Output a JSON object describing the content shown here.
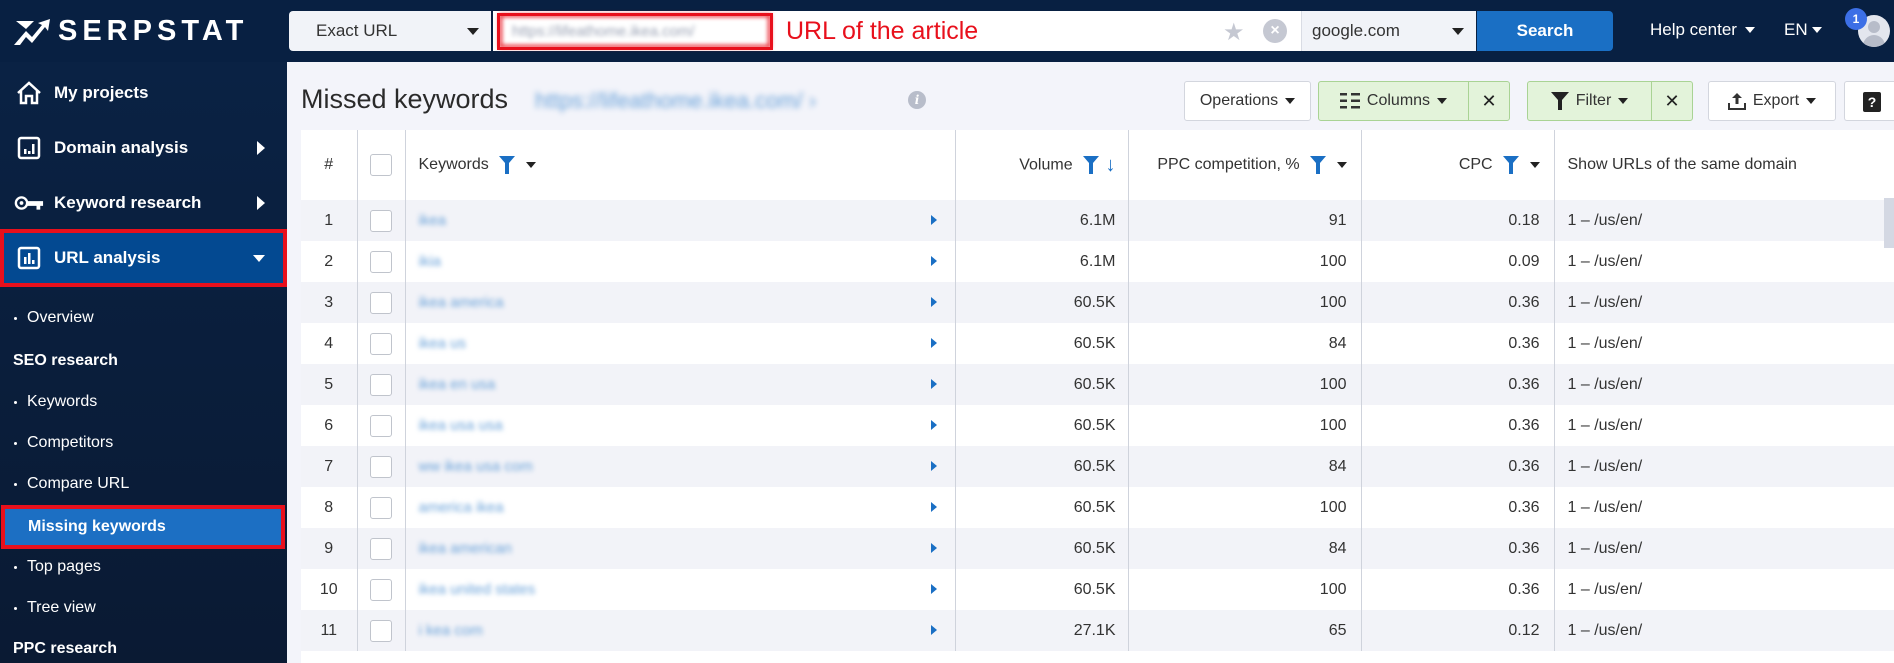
{
  "app": {
    "logo_text": "SERPSTAT"
  },
  "topbar": {
    "search_type": "Exact URL",
    "url_value": "https://lifeathome.ikea.com/",
    "url_annotation": "URL of the article",
    "engine": "google.com",
    "search_label": "Search",
    "help_center": "Help center",
    "language": "EN",
    "notification_count": "1"
  },
  "sidebar": {
    "main_items": [
      {
        "label": "My projects",
        "icon": "home-icon"
      },
      {
        "label": "Domain analysis",
        "icon": "chart-box-icon"
      },
      {
        "label": "Keyword research",
        "icon": "key-icon"
      },
      {
        "label": "URL analysis",
        "icon": "bar-chart-icon"
      }
    ],
    "overview": "Overview",
    "seo_section": "SEO research",
    "seo_items": [
      "Keywords",
      "Competitors",
      "Compare URL",
      "Missing keywords",
      "Top pages",
      "Tree view"
    ],
    "ppc_section": "PPC research"
  },
  "main": {
    "title": "Missed keywords",
    "url": "https://lifeathome.ikea.com/ ›",
    "toolbar": {
      "operations": "Operations",
      "columns": "Columns",
      "filter": "Filter",
      "export": "Export",
      "help": "?"
    }
  },
  "table": {
    "headers": {
      "num": "#",
      "keywords": "Keywords",
      "volume": "Volume",
      "ppc": "PPC competition, %",
      "cpc": "CPC",
      "urls": "Show URLs of the same domain"
    },
    "rows": [
      {
        "num": "1",
        "keyword": "ikea",
        "volume": "6.1M",
        "ppc": "91",
        "cpc": "0.18",
        "url": "1 – /us/en/"
      },
      {
        "num": "2",
        "keyword": "ikia",
        "volume": "6.1M",
        "ppc": "100",
        "cpc": "0.09",
        "url": "1 – /us/en/"
      },
      {
        "num": "3",
        "keyword": "ikea america",
        "volume": "60.5K",
        "ppc": "100",
        "cpc": "0.36",
        "url": "1 – /us/en/"
      },
      {
        "num": "4",
        "keyword": "ikea us",
        "volume": "60.5K",
        "ppc": "84",
        "cpc": "0.36",
        "url": "1 – /us/en/"
      },
      {
        "num": "5",
        "keyword": "ikea en usa",
        "volume": "60.5K",
        "ppc": "100",
        "cpc": "0.36",
        "url": "1 – /us/en/"
      },
      {
        "num": "6",
        "keyword": "ikea usa usa",
        "volume": "60.5K",
        "ppc": "100",
        "cpc": "0.36",
        "url": "1 – /us/en/"
      },
      {
        "num": "7",
        "keyword": "ww ikea usa com",
        "volume": "60.5K",
        "ppc": "84",
        "cpc": "0.36",
        "url": "1 – /us/en/"
      },
      {
        "num": "8",
        "keyword": "america ikea",
        "volume": "60.5K",
        "ppc": "100",
        "cpc": "0.36",
        "url": "1 – /us/en/"
      },
      {
        "num": "9",
        "keyword": "ikea american",
        "volume": "60.5K",
        "ppc": "84",
        "cpc": "0.36",
        "url": "1 – /us/en/"
      },
      {
        "num": "10",
        "keyword": "ikea united states",
        "volume": "60.5K",
        "ppc": "100",
        "cpc": "0.36",
        "url": "1 – /us/en/"
      },
      {
        "num": "11",
        "keyword": "i kea com",
        "volume": "27.1K",
        "ppc": "65",
        "cpc": "0.12",
        "url": "1 – /us/en/"
      }
    ]
  },
  "colors": {
    "topbar": "#082042",
    "accent": "#1a6fc4",
    "highlight_frame": "#e8101c",
    "active_nav": "#034991",
    "filter_active": "#e3f3da"
  }
}
